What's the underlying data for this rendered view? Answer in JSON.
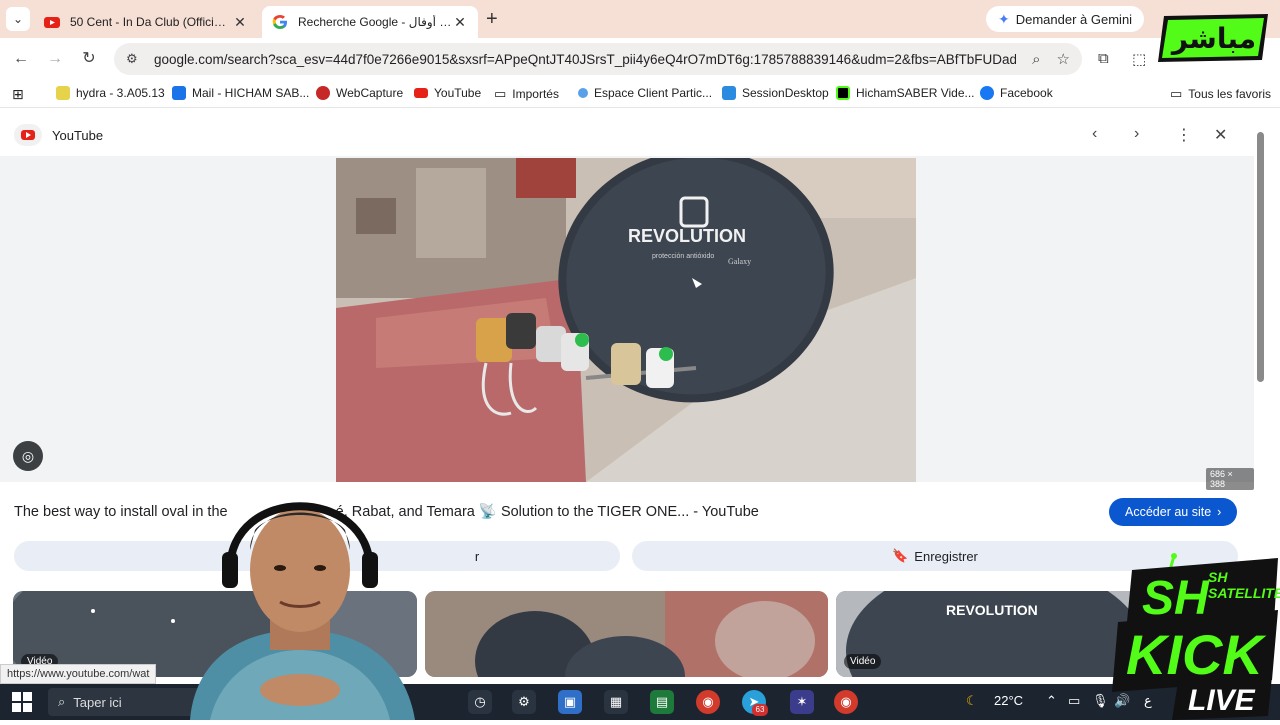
{
  "browser": {
    "tabs": [
      {
        "title": "50 Cent - In Da Club (Official M",
        "icon": "youtube-icon",
        "active": false
      },
      {
        "title": "Recherche Google - طبق أوفال",
        "icon": "google-icon",
        "active": true
      }
    ],
    "gemini_label": "Demander à Gemini",
    "url": "google.com/search?sca_esv=44d7f0e7266e9015&sxsrf=APpeQntJT40JSrsT_pii4y6eQ4rO7mDT6g:1785788839146&udm=2&fbs=ABfTbFUDadgeu2...",
    "bookmarks": [
      {
        "label": "hydra - 3.A05.13",
        "icon": "hydra-icon"
      },
      {
        "label": "Mail - HICHAM SAB...",
        "icon": "outlook-icon"
      },
      {
        "label": "WebCapture",
        "icon": "webcapture-icon"
      },
      {
        "label": "YouTube",
        "icon": "youtube-icon"
      },
      {
        "label": "Importés",
        "icon": "folder-icon"
      },
      {
        "label": "Espace Client Partic...",
        "icon": "bank-icon"
      },
      {
        "label": "SessionDesktop",
        "icon": "session-icon"
      },
      {
        "label": "HichamSABER Vide...",
        "icon": "kick-icon"
      },
      {
        "label": "Facebook",
        "icon": "facebook-icon"
      }
    ],
    "all_bookmarks_label": "Tous les favoris"
  },
  "viewer": {
    "source": "YouTube",
    "image_dims": "686 × 388",
    "caption": "The best way to install oval in the",
    "caption_tail": "é, Rabat, and Temara 📡 Solution to the TIGER ONE... - YouTube",
    "visit_label": "Accéder au site",
    "share_label": "r",
    "save_label": "Enregistrer",
    "thumbs": [
      {
        "badge": "Vidéo"
      },
      {
        "badge": ""
      },
      {
        "badge": "Vidéo"
      }
    ],
    "dish_brand": "REVOLUTION",
    "dish_sub": "protección antióxido",
    "dish_model": "Galaxy",
    "hover_url": "https://www.youtube.com/wat"
  },
  "taskbar": {
    "search_placeholder": "Taper ici",
    "weather": "22°C",
    "lang": "ع",
    "badge": "63"
  },
  "overlays": {
    "live_ar": "مباشر",
    "sh": "SH",
    "sh_small": "SH",
    "satellite": "SATELLITE",
    "kick": "KICK",
    "live": "LIVE"
  },
  "colors": {
    "tabbar": "#f6dfd5",
    "accent_blue": "#0b57d0",
    "pill_bg": "#e9eef6",
    "kick_green": "#53fc18"
  }
}
